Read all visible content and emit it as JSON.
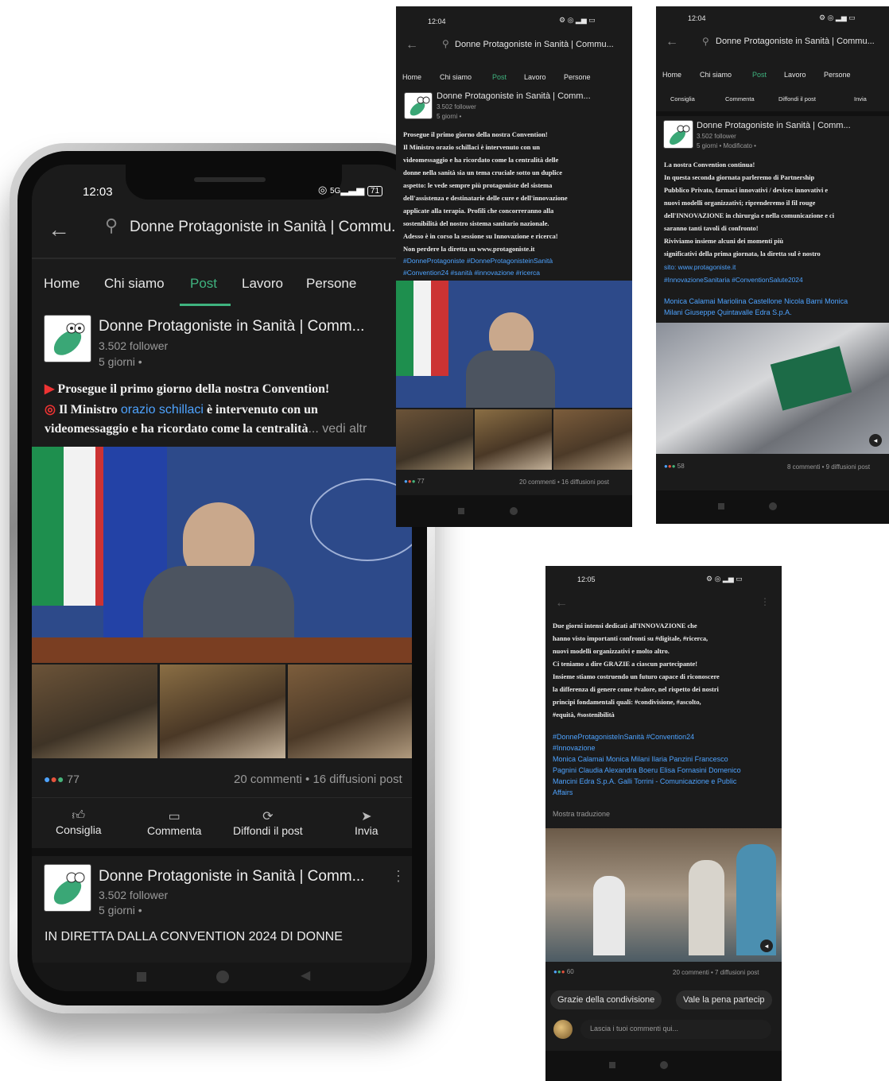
{
  "shared": {
    "page_name": "Donne Protagoniste in Sanità | Commu...",
    "page_name_short": "Donne Protagoniste in Sanità | Comm...",
    "followers": "3.502 follower",
    "age": "5 giorni •",
    "age_modified": "5 giorni • Modificato •",
    "tabs": [
      "Home",
      "Chi siamo",
      "Post",
      "Lavoro",
      "Persone"
    ],
    "actions": [
      "Consiglia",
      "Commenta",
      "Diffondi il post",
      "Invia"
    ],
    "colors": {
      "bg": "#1b1b1b",
      "accent": "#3fb37f",
      "link": "#4ea3ff"
    }
  },
  "phone_main": {
    "time": "12:03",
    "battery": "71",
    "post": {
      "line1": "Prosegue il primo giorno della nostra Convention!",
      "line2_pre": "Il Ministro",
      "line2_link": "orazio schillaci",
      "line2_post": "è intervenuto con un",
      "line3": "videomessaggio e ha ricordato come la centralità",
      "more": "... vedi altr",
      "reactions": "77",
      "stats": "20 commenti • 16 diffusioni post"
    },
    "post2": {
      "text": "IN DIRETTA DALLA CONVENTION 2024 DI DONNE"
    }
  },
  "shot_top_middle": {
    "time": "12:04",
    "title": "Donne Protagoniste in Sanità | Commu...",
    "body": [
      "Prosegue il primo giorno della nostra Convention!",
      "Il Ministro orazio schillaci è intervenuto con un",
      "videomessaggio e ha ricordato come la centralità delle",
      "donne nella sanità sia un tema cruciale sotto un duplice",
      "aspetto: le vede sempre più protagoniste del sistema",
      "dell'assistenza e destinatarie delle cure e dell'innovazione",
      "applicate alla terapia. Profili che concorreranno alla",
      "sostenibilità del nostro sistema sanitario nazionale.",
      "Adesso è in corso la sessione su Innovazione e ricerca!",
      "Non perdere la diretta su www.protagoniste.it"
    ],
    "hashtags": [
      "#DonneProtagoniste #DonneProtagonisteinSanità",
      "#Convention24 #sanità #innovazione #ricerca"
    ],
    "reactions": "77",
    "stats": "20 commenti • 16 diffusioni post"
  },
  "shot_top_right": {
    "time": "12:04",
    "title": "Donne Protagoniste in Sanità | Commu...",
    "body": [
      "La nostra Convention continua!",
      "In questa seconda giornata parleremo di Partnership",
      "Pubblico Privato, farmaci innovativi / devices innovativi e",
      "nuovi modelli organizzativi; riprenderemo il fil rouge",
      "dell'INNOVAZIONE in chirurgia e nella comunicazione e ci",
      "saranno tanti tavoli di confronto!",
      "Riviviamo insieme alcuni dei momenti più",
      "significativi della prima giornata, la diretta sul è nostro",
      "sito: www.protagoniste.it",
      "#InnovazioneSanitaria #ConventionSalute2024"
    ],
    "mentions": [
      "Monica Calamai Mariolina Castellone Nicola Barni Monica",
      "Milani Giuseppe Quintavalle Edra S.p.A."
    ],
    "reactions": "58",
    "stats": "8 commenti • 9 diffusioni post"
  },
  "shot_bottom": {
    "time": "12:05",
    "body": [
      "Due giorni intensi dedicati all'INNOVAZIONE che",
      "hanno visto importanti confronti su #digitale, #ricerca,",
      "nuovi modelli organizzativi e molto altro.",
      "Ci teniamo a dire GRAZIE a ciascun partecipante!",
      "Insieme stiamo costruendo un futuro capace di riconoscere",
      "la differenza di genere come #valore, nel rispetto dei nostri",
      "principi fondamentali quali: #condivisione, #ascolto,",
      "#equità, #sostenibilità"
    ],
    "hashtags": [
      "#DonneProtagonisteInSanità #Convention24",
      "#Innovazione"
    ],
    "mentions": [
      "Monica Calamai Monica Milani Ilaria Panzini Francesco",
      "Pagnini Claudia Alexandra Boeru Elisa Fornasini Domenico",
      "Mancini Edra S.p.A. Galli Torrini - Comunicazione e Public",
      "Affairs"
    ],
    "translate": "Mostra traduzione",
    "reactions": "60",
    "stats": "20 commenti • 7 diffusioni post",
    "chips": [
      "Grazie della condivisione",
      "Vale la pena partecip"
    ],
    "comment_placeholder": "Lascia i tuoi commenti qui..."
  }
}
